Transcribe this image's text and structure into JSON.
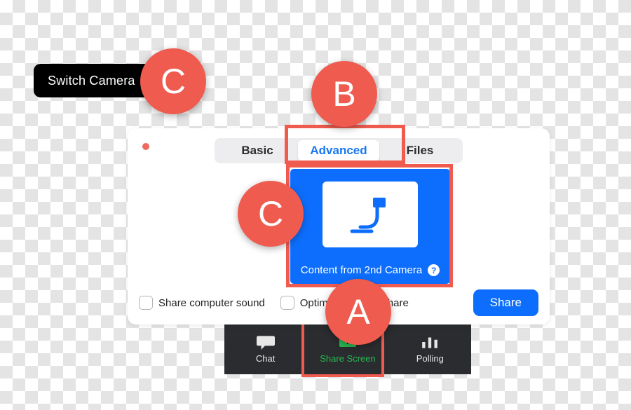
{
  "switch_camera_label": "Switch Camera",
  "tabs": {
    "basic": "Basic",
    "advanced": "Advanced",
    "files": "Files"
  },
  "card": {
    "label": "Content from 2nd Camera",
    "help": "?"
  },
  "options": {
    "share_sound": "Share computer sound",
    "optimize": "Optimize Screen Share"
  },
  "share_button": "Share",
  "toolbar": {
    "chat": "Chat",
    "share_screen": "Share Screen",
    "polling": "Polling"
  },
  "callouts": {
    "a": "A",
    "b": "B",
    "c1": "C",
    "c2": "C"
  }
}
